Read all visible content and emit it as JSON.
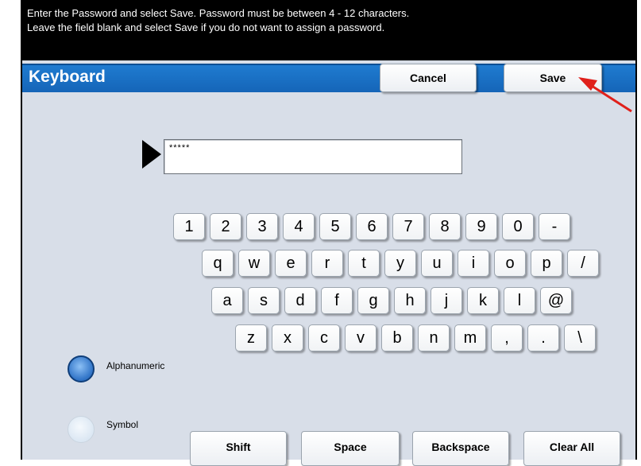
{
  "message": {
    "line1": "Enter the Password and select Save.  Password must be between 4 - 12 characters.",
    "line2": "Leave the field blank and select Save if you do not want to assign a password."
  },
  "header": {
    "title": "Keyboard",
    "cancel_label": "Cancel",
    "save_label": "Save"
  },
  "password_field": {
    "value": "*****"
  },
  "keyboard": {
    "row1": [
      "1",
      "2",
      "3",
      "4",
      "5",
      "6",
      "7",
      "8",
      "9",
      "0",
      "-"
    ],
    "row2": [
      "q",
      "w",
      "e",
      "r",
      "t",
      "y",
      "u",
      "i",
      "o",
      "p",
      "/"
    ],
    "row3": [
      "a",
      "s",
      "d",
      "f",
      "g",
      "h",
      "j",
      "k",
      "l",
      "@"
    ],
    "row4": [
      "z",
      "x",
      "c",
      "v",
      "b",
      "n",
      "m",
      ",",
      ".",
      "\\"
    ]
  },
  "modes": {
    "alphanumeric_label": "Alphanumeric",
    "symbol_label": "Symbol",
    "selected": "Alphanumeric"
  },
  "actions": {
    "shift": "Shift",
    "space": "Space",
    "backspace": "Backspace",
    "clear_all": "Clear All"
  },
  "colors": {
    "title_bar": "#1a6fc4",
    "annotation_arrow": "#e0201b",
    "background": "#d8dee8"
  }
}
